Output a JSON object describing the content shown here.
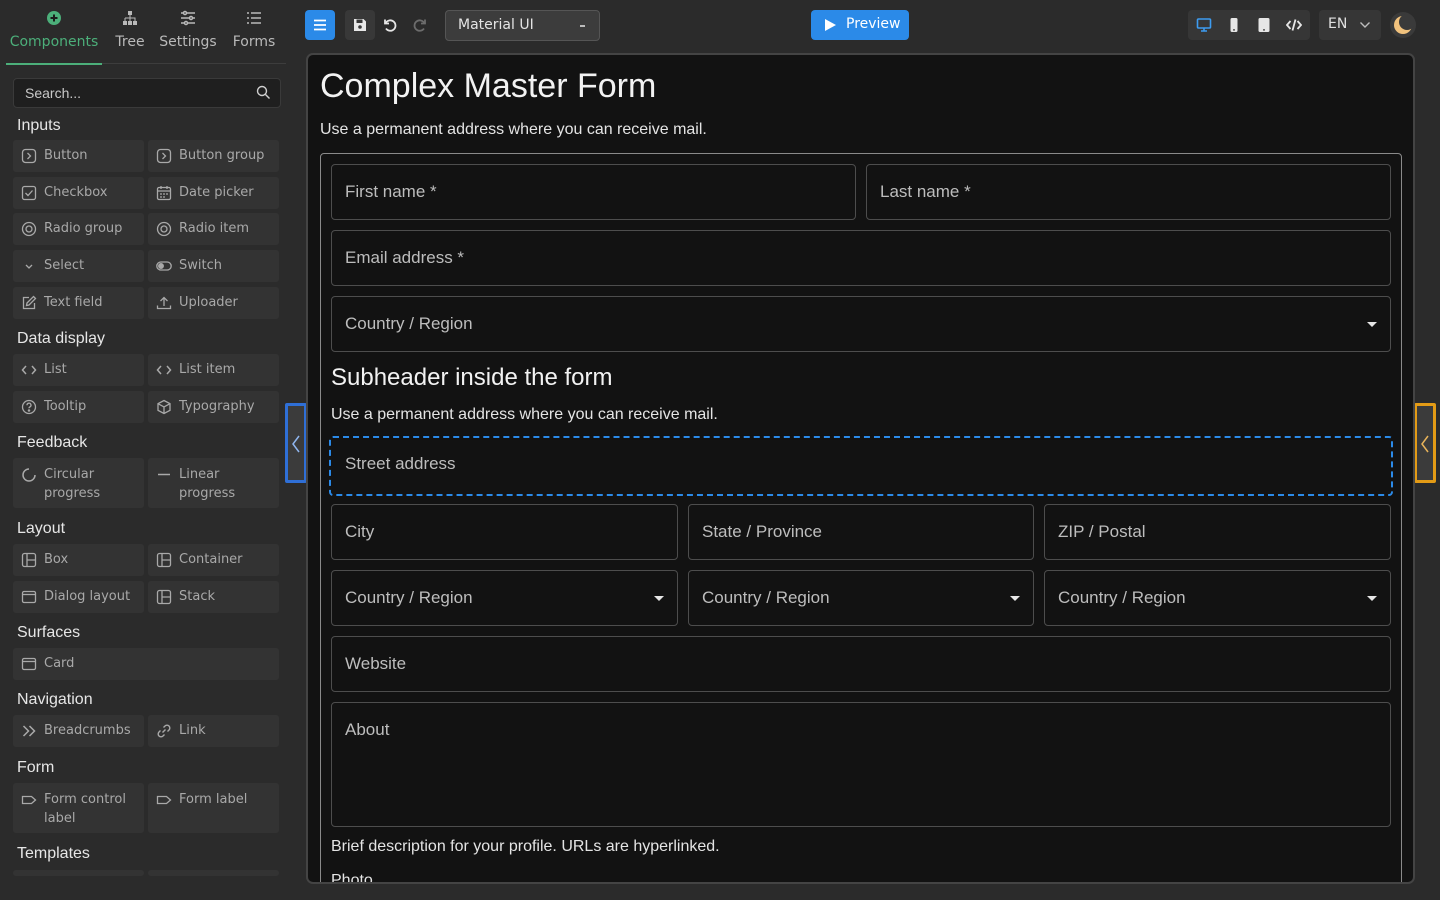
{
  "sidebar": {
    "tabs": [
      {
        "label": "Components",
        "icon": "plus-circle-icon"
      },
      {
        "label": "Tree",
        "icon": "tree-icon"
      },
      {
        "label": "Settings",
        "icon": "sliders-icon"
      },
      {
        "label": "Forms",
        "icon": "list-icon"
      }
    ],
    "search_placeholder": "Search...",
    "categories": {
      "inputs": "Inputs",
      "data_display": "Data display",
      "feedback": "Feedback",
      "layout": "Layout",
      "surfaces": "Surfaces",
      "navigation": "Navigation",
      "form": "Form",
      "templates": "Templates"
    },
    "components": {
      "button": "Button",
      "button_group": "Button group",
      "checkbox": "Checkbox",
      "date_picker": "Date picker",
      "radio_group": "Radio group",
      "radio_item": "Radio item",
      "select": "Select",
      "switch": "Switch",
      "text_field": "Text field",
      "uploader": "Uploader",
      "list": "List",
      "list_item": "List item",
      "tooltip": "Tooltip",
      "typography": "Typography",
      "circular_progress_1": "Circular",
      "circular_progress_2": "progress",
      "linear_progress_1": "Linear",
      "linear_progress_2": "progress",
      "box": "Box",
      "container": "Container",
      "dialog_layout": "Dialog layout",
      "stack": "Stack",
      "card": "Card",
      "breadcrumbs": "Breadcrumbs",
      "link": "Link",
      "form_control_label_1": "Form control",
      "form_control_label_2": "label",
      "form_label": "Form label"
    }
  },
  "toolbar": {
    "library": "Material UI",
    "preview_label": "Preview",
    "language": "EN",
    "accent_color": "#2b8ae8"
  },
  "form": {
    "title": "Complex Master Form",
    "description": "Use a permanent address where you can receive mail.",
    "fields": {
      "first_name": "First name *",
      "last_name": "Last name *",
      "email": "Email address *",
      "country": "Country / Region",
      "street": "Street address",
      "city": "City",
      "state": "State / Province",
      "zip": "ZIP / Postal",
      "country_a": "Country / Region",
      "country_b": "Country / Region",
      "country_c": "Country / Region",
      "website": "Website",
      "about": "About"
    },
    "subheader": "Subheader inside the form",
    "sub_description": "Use a permanent address where you can receive mail.",
    "about_helper": "Brief description for your profile. URLs are hyperlinked.",
    "photo_label": "Photo"
  }
}
